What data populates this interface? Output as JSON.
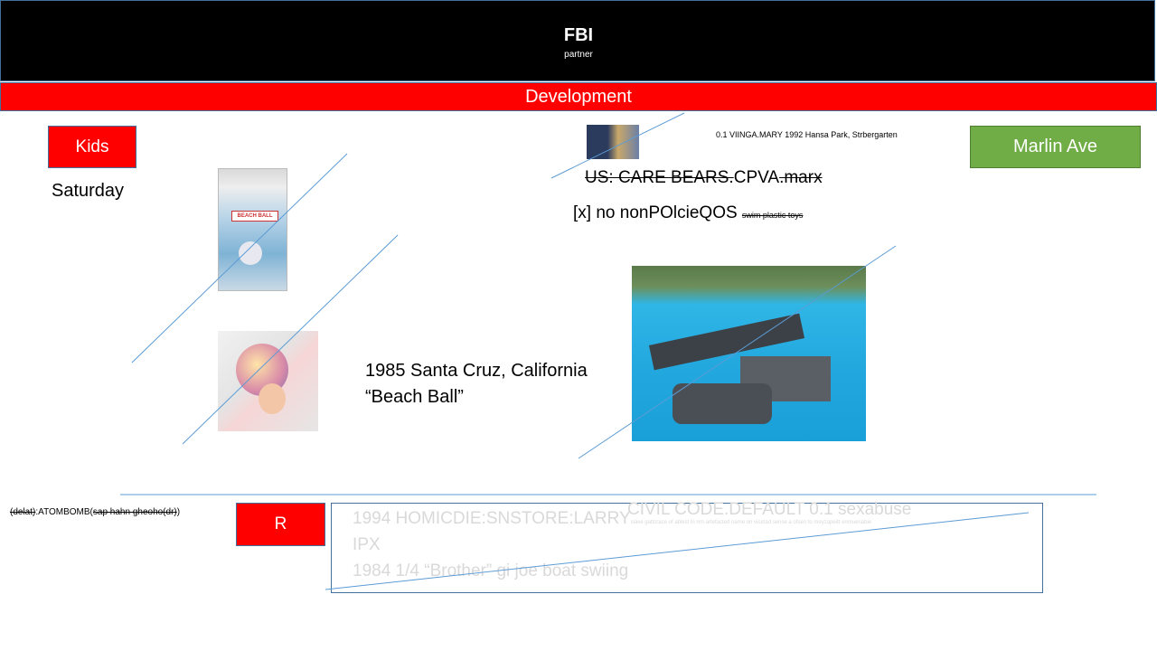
{
  "header": {
    "title": "FBI",
    "subtitle": "partner"
  },
  "bar": {
    "label": "Development"
  },
  "buttons": {
    "kids": "Kids",
    "marlin": "Marlin Ave",
    "r": "R"
  },
  "labels": {
    "saturday": "Saturday",
    "credit": "0.1 VIINGA.MARY 1992 Hansa Park, Strbergarten",
    "care_bears_struck": "US: CARE BEARS.",
    "care_bears_mid": "CPVA",
    "care_bears_tail": ".marx",
    "policy_main": "[x] no nonPOlcieQOS ",
    "policy_small": "swim plastic toys",
    "caption_line1": "1985 Santa Cruz, California",
    "caption_line2": "“Beach Ball”",
    "atom_struck": "(delat)",
    "atom_mid": ":ATOMBOMB(",
    "atom_struck2": "sap hahn gheoho(dr)",
    "atom_end": ")"
  },
  "photos": {
    "beachball_pkg_text": "BEACH BALL"
  },
  "box": {
    "line1": "1994 HOMICDIE:SNSTORE:LARRY",
    "line1_tiny": "slave gattsrace of ablest ln nrn artefacted name on vicetad sense a ofsen to meyzapeitt enmuenabie",
    "line2": "IPX",
    "line3": "1984 1/4 “Brother” gi joe boat swiing",
    "civil": "CIVIL CODE.DEFAULT 0.1 sexabuse"
  },
  "colors": {
    "red": "#ff0000",
    "green": "#70ad47",
    "line": "#5b9bd5",
    "black": "#000000"
  }
}
